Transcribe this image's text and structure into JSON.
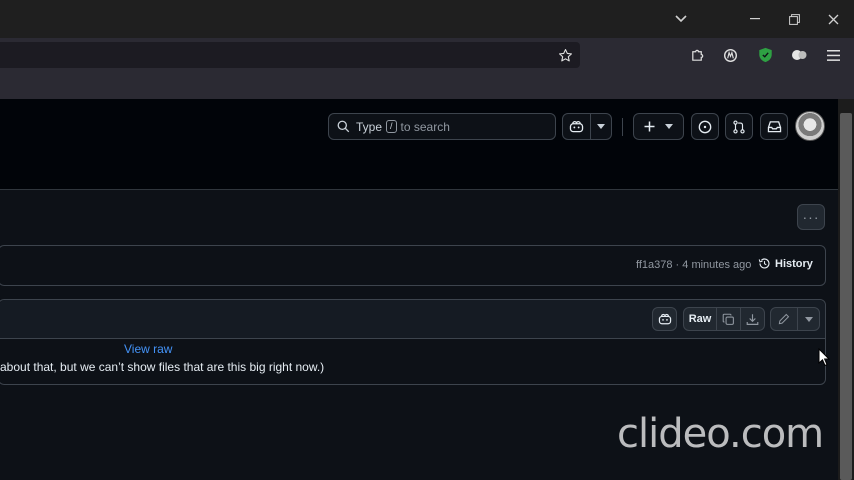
{
  "search": {
    "placeholder_before": "Type",
    "kbd": "/",
    "placeholder_after": "to search"
  },
  "file": {
    "commit_text": "ff1a378 · 4 minutes ago",
    "history_label": "History",
    "raw_label": "Raw",
    "view_raw_label": "View raw",
    "too_big_message": "about that, but we can’t show files that are this big right now.)"
  },
  "watermark": "clideo.com",
  "colors": {
    "link": "#4493f8",
    "header_bg": "#010409",
    "page_bg": "#0d1117",
    "border": "#3d444d"
  }
}
